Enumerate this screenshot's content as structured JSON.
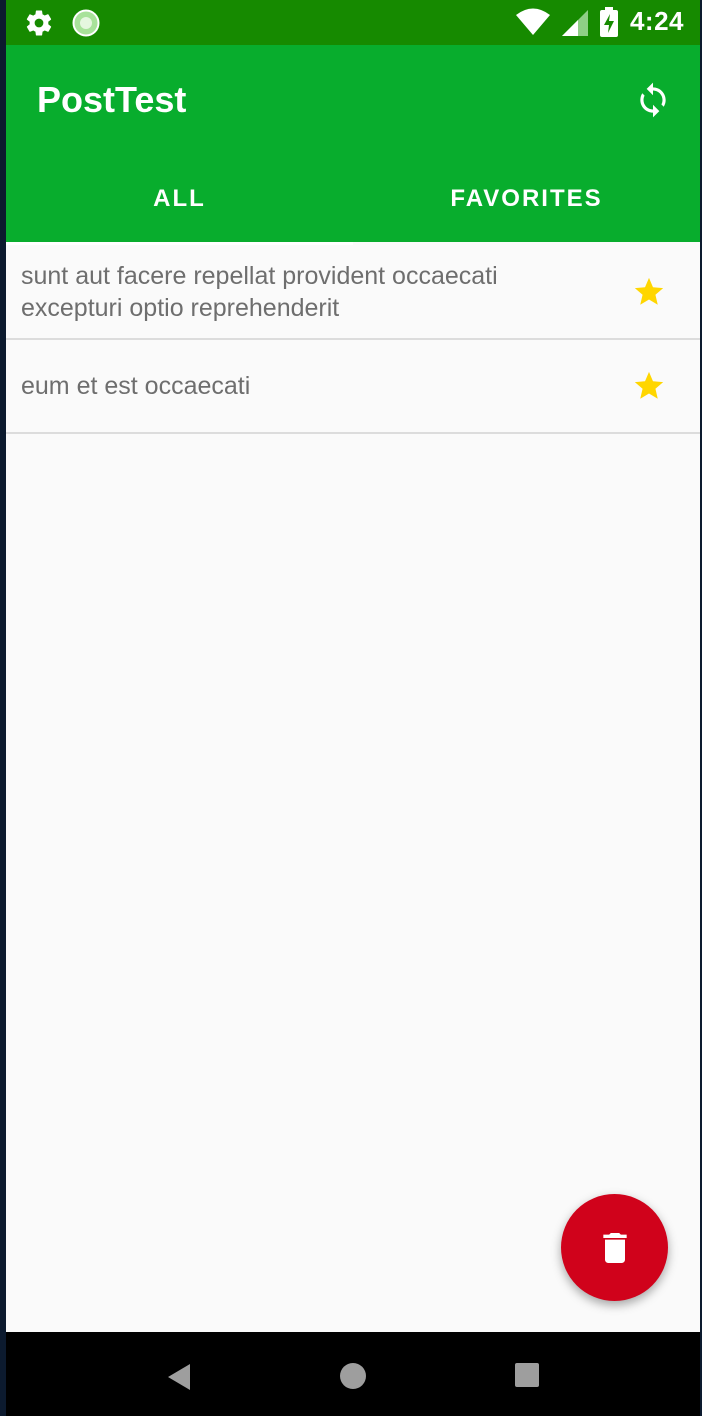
{
  "status_bar": {
    "time": "4:24",
    "icons_left": [
      "settings-icon",
      "app-notification-icon"
    ],
    "icons_right": [
      "wifi-icon",
      "cell-signal-icon",
      "battery-charging-icon"
    ]
  },
  "app_bar": {
    "title": "PostTest",
    "action_icon": "refresh-icon"
  },
  "tabs": [
    {
      "label": "ALL",
      "selected": true
    },
    {
      "label": "FAVORITES",
      "selected": false
    }
  ],
  "posts": [
    {
      "title": "sunt aut facere repellat provident occaecati excepturi optio reprehenderit",
      "favorite": true
    },
    {
      "title": "eum et est occaecati",
      "favorite": true
    }
  ],
  "fab": {
    "icon": "trash-icon"
  },
  "nav_bar": {
    "icons": [
      "back-icon",
      "home-icon",
      "recents-icon"
    ]
  },
  "colors": {
    "status_bar": "#168a00",
    "app_bar": "#08ad2d",
    "star": "#ffd600",
    "fab": "#d0021b",
    "list_text": "#6e6e6e"
  }
}
